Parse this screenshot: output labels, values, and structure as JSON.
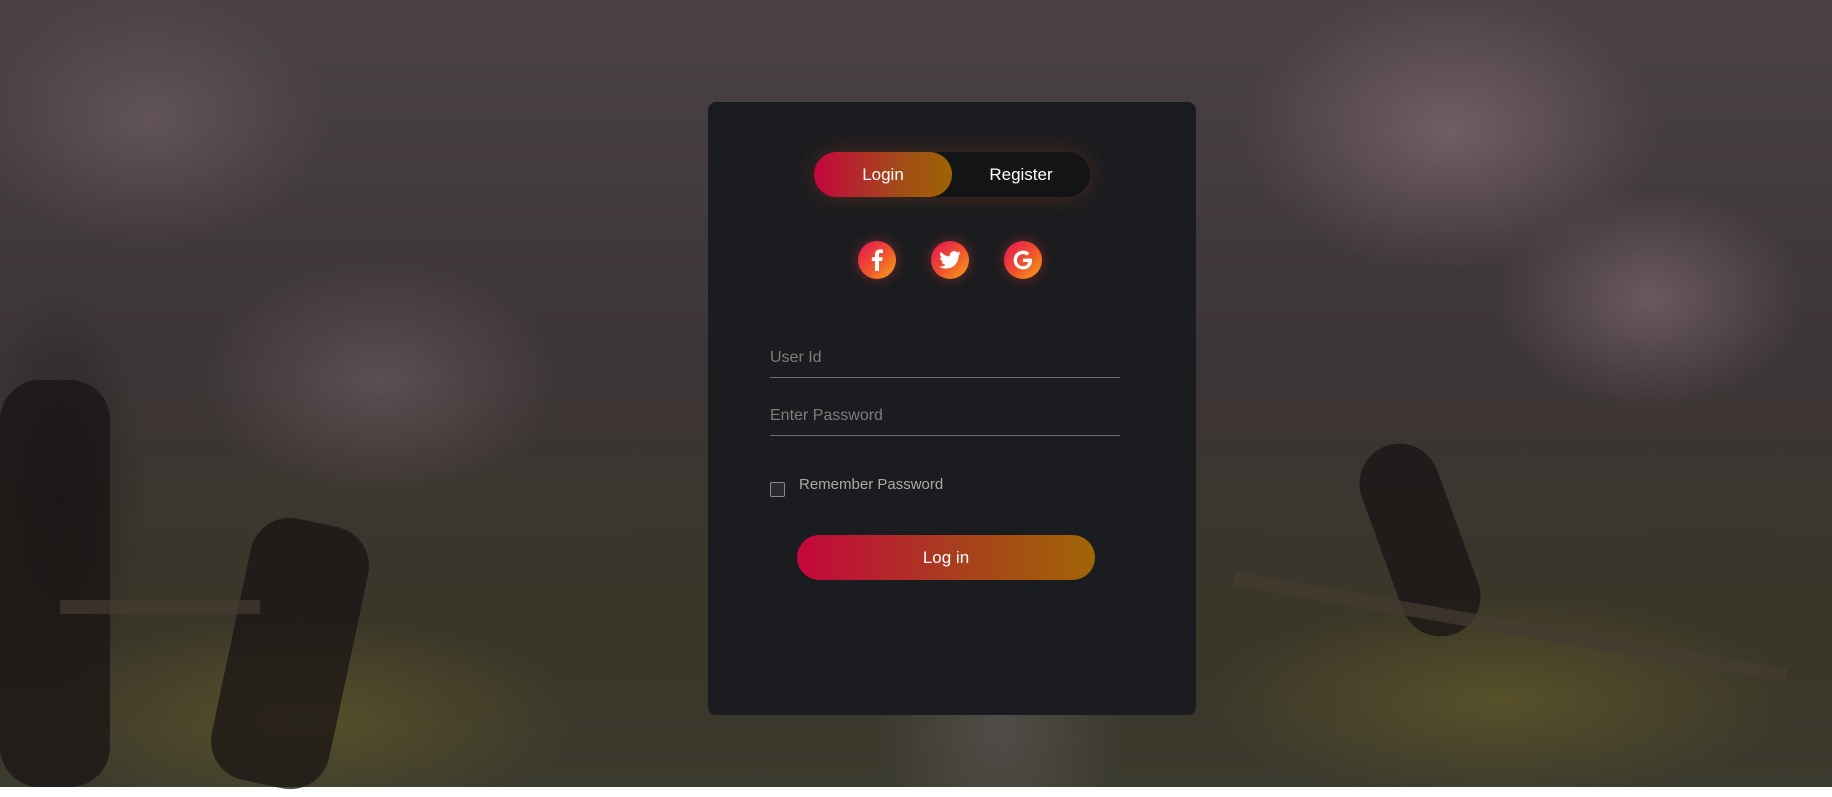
{
  "auth_toggle": {
    "login_label": "Login",
    "register_label": "Register",
    "active": "login"
  },
  "socials": [
    {
      "name": "facebook-icon"
    },
    {
      "name": "twitter-icon"
    },
    {
      "name": "google-icon"
    }
  ],
  "form": {
    "user_id": {
      "value": "",
      "placeholder": "User Id"
    },
    "password": {
      "value": "",
      "placeholder": "Enter Password"
    },
    "remember_label": "Remember Password",
    "remember_checked": false,
    "submit_label": "Log in"
  },
  "colors": {
    "card_bg": "#1b1c1f",
    "gradient_start": "#c4063d",
    "gradient_end": "#9c6403",
    "social_gradient_start": "#e3125a",
    "social_gradient_end": "#f7a51b"
  }
}
